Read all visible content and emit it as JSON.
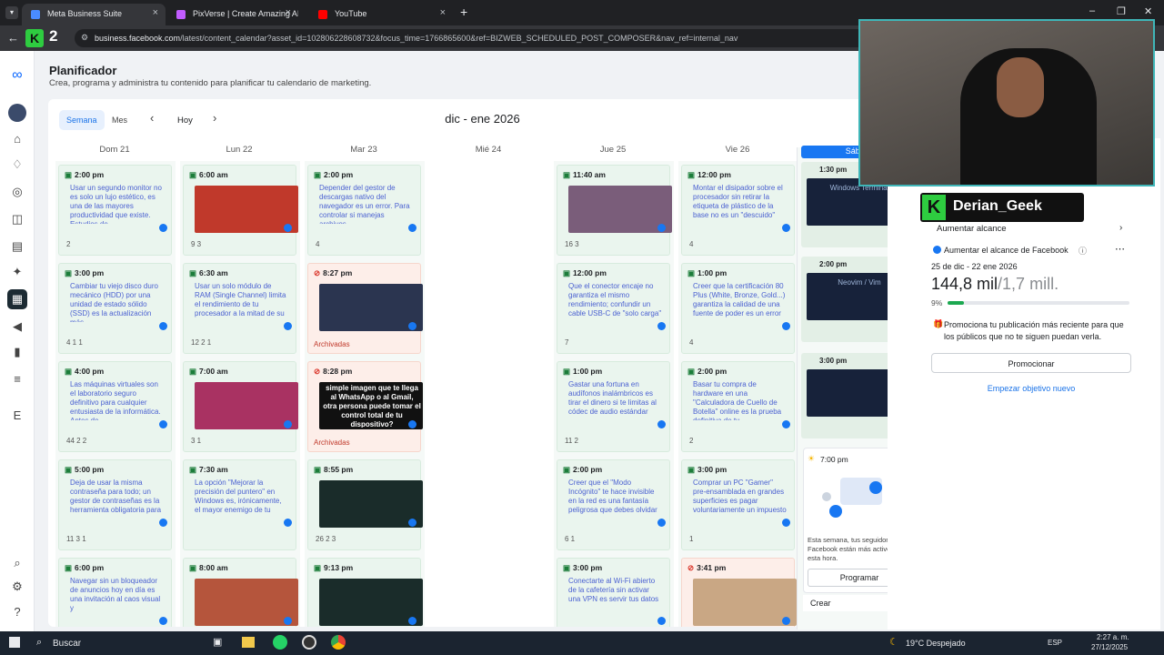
{
  "browser": {
    "tabs": [
      {
        "label": "Meta Business Suite",
        "active": true,
        "color": "#4a8cff"
      },
      {
        "label": "PixVerse | Create Amazing AI V",
        "active": false,
        "color": "#c15cff"
      },
      {
        "label": "YouTube",
        "active": false,
        "color": "#ff0000"
      }
    ],
    "new_tab": "+",
    "url_host": "business.facebook.com",
    "url_path": "/latest/content_calendar?asset_id=102806228608732&focus_time=1766865600&ref=BIZWEB_SCHEDULED_POST_COMPOSER&nav_ref=internal_nav"
  },
  "overlay": {
    "logo_k": "K",
    "logo_2": "2",
    "streamer": "Derian_Geek"
  },
  "page": {
    "title": "Planificador",
    "subtitle": "Crea, programa y administra tu contenido para planificar tu calendario de marketing."
  },
  "toolbar": {
    "week": "Semana",
    "month": "Mes",
    "today": "Hoy",
    "prev": "‹",
    "next": "›",
    "range": "dic - ene 2026"
  },
  "days": [
    "Dom 21",
    "Lun 22",
    "Mar 23",
    "Mié 24",
    "Jue 25",
    "Vie 26",
    "Sáb 27"
  ],
  "columns": [
    {
      "cards": [
        {
          "time": "2:00 pm",
          "text": "Usar un segundo monitor no es solo un lujo estético, es una de las mayores productividad que existe. Estudios de",
          "stats": "2"
        },
        {
          "time": "3:00 pm",
          "text": "Cambiar tu viejo disco duro mecánico (HDD) por una unidad de estado sólido (SSD) es la actualización más",
          "stats": "4   1   1"
        },
        {
          "time": "4:00 pm",
          "text": "Las máquinas virtuales son el laboratorio seguro definitivo para cualquier entusiasta de la informática. Antes de",
          "stats": "44   2   2"
        },
        {
          "time": "5:00 pm",
          "text": "Deja de usar la misma contraseña para todo; un gestor de contraseñas es la herramienta obligatoria para",
          "stats": "11   3   1"
        },
        {
          "time": "6:00 pm",
          "text": "Navegar sin un bloqueador de anuncios hoy en día es una invitación al caos visual y",
          "stats": ""
        }
      ]
    },
    {
      "cards": [
        {
          "time": "6:00 am",
          "img": "#c0392b",
          "stats": "9   3"
        },
        {
          "time": "6:30 am",
          "text": "Usar un solo módulo de RAM (Single Channel) limita el rendimiento de tu procesador a la mitad de su",
          "stats": "12   2   1"
        },
        {
          "time": "7:00 am",
          "img": "#a93262",
          "stats": "3   1"
        },
        {
          "time": "7:30 am",
          "text": "La opción \"Mejorar la precisión del puntero\" en Windows es, irónicamente, el mayor enemigo de tu",
          "stats": ""
        },
        {
          "time": "8:00 am",
          "img": "#b5553c",
          "stats": ""
        }
      ]
    },
    {
      "cards": [
        {
          "time": "2:00 pm",
          "text": "Depender del gestor de descargas nativo del navegador es un error. Para controlar si manejas archivos",
          "stats": "4"
        },
        {
          "time": "8:27 pm",
          "err": true,
          "img": "#2b3550",
          "archived": "Archivadas"
        },
        {
          "time": "8:28 pm",
          "err": true,
          "img": "#111111",
          "caption": "simple imagen que te llega al WhatsApp o al Gmail, otra persona puede tomar el control total de tu dispositivo?",
          "archived": "Archivadas"
        },
        {
          "time": "8:55 pm",
          "img": "#1a2c2a",
          "stats": "26   2   3"
        },
        {
          "time": "9:13 pm",
          "img": "#1a2c2a",
          "stats": ""
        }
      ]
    },
    {
      "cards": []
    },
    {
      "cards": [
        {
          "time": "11:40 am",
          "img": "#7a5d7a",
          "stats": "16   3"
        },
        {
          "time": "12:00 pm",
          "text": "Que el conector encaje no garantiza el mismo rendimiento; confundir un cable USB-C de \"solo carga\"",
          "stats": "7"
        },
        {
          "time": "1:00 pm",
          "text": "Gastar una fortuna en audífonos inalámbricos es tirar el dinero si te limitas al códec de audio estándar",
          "stats": "11   2"
        },
        {
          "time": "2:00 pm",
          "text": "Creer que el \"Modo Incógnito\" te hace invisible en la red es una fantasía peligrosa que debes olvidar",
          "stats": "6   1"
        },
        {
          "time": "3:00 pm",
          "text": "Conectarte al Wi-Fi abierto de la cafetería sin activar una VPN es servir tus datos",
          "stats": ""
        }
      ]
    },
    {
      "cards": [
        {
          "time": "12:00 pm",
          "text": "Montar el disipador sobre el procesador sin retirar la etiqueta de plástico de la base no es un \"descuido\"",
          "stats": "4"
        },
        {
          "time": "1:00 pm",
          "text": "Creer que la certificación 80 Plus (White, Bronze, Gold...) garantiza la calidad de una fuente de poder es un error",
          "stats": "4"
        },
        {
          "time": "2:00 pm",
          "text": "Basar tu compra de hardware en una \"Calculadora de Cuello de Botella\" online es la prueba definitiva de tu",
          "stats": "2"
        },
        {
          "time": "3:00 pm",
          "text": "Comprar un PC \"Gamer\" pre-ensamblada en grandes superficies es pagar voluntariamente un impuesto",
          "stats": "1"
        },
        {
          "time": "3:41 pm",
          "err": true,
          "img": "#c9a784",
          "stats": ""
        }
      ]
    }
  ],
  "saturday": {
    "slots": [
      {
        "time": "1:30 pm",
        "caption": "Windows Terminal"
      },
      {
        "time": "2:00 pm",
        "caption": "Neovim / Vim"
      },
      {
        "time": "3:00 pm",
        "caption": ""
      }
    ],
    "tip_time": "7:00 pm",
    "tip_text": "Esta semana, tus seguidores de Facebook están más activos a esta hora.",
    "schedule_button": "Programar",
    "create_button": "Crear"
  },
  "boost": {
    "header": "Aumentar alcance",
    "subheader": "Aumentar el alcance de Facebook",
    "range": "25 de dic - 22 ene 2026",
    "value": "144,8 mil",
    "total": "/1,7 mill.",
    "percent": "9%",
    "progress": 0.09,
    "promo_text": "Promociona tu publicación más reciente para que los públicos que no te siguen puedan verla.",
    "promote_button": "Promocionar",
    "new_goal": "Empezar objetivo nuevo"
  },
  "taskbar": {
    "search": "Buscar",
    "weather": "19°C Despejado",
    "lang": "ESP",
    "time": "2:27 a. m.",
    "date": "27/12/2025"
  }
}
